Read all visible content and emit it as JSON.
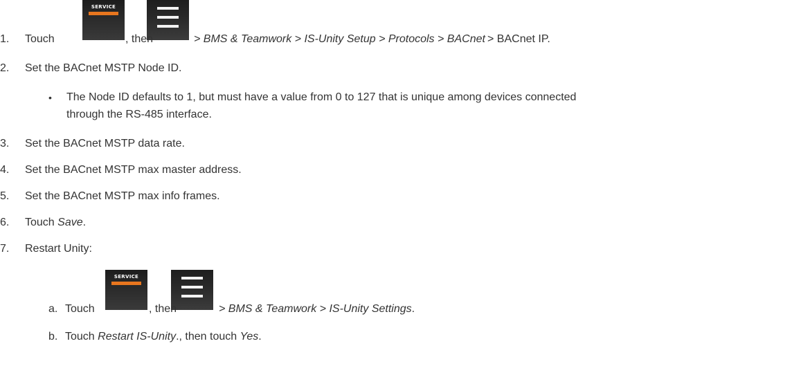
{
  "icons": {
    "service_label": "SERVICE",
    "service_accent": "#e8761e",
    "menu_icon": "hamburger-menu-icon"
  },
  "steps": [
    {
      "num": "1.",
      "touch": "Touch",
      "then": ", then",
      "path": "> BMS & Teamwork > IS-Unity Setup > Protocols > BACnet",
      "tail": "> BACnet IP."
    },
    {
      "num": "2.",
      "text": "Set the BACnet MSTP Node ID."
    },
    {
      "num": "3.",
      "text": "Set the BACnet MSTP data rate."
    },
    {
      "num": "4.",
      "text": "Set the BACnet MSTP max master address."
    },
    {
      "num": "5.",
      "text": "Set the BACnet MSTP max info frames."
    },
    {
      "num": "6.",
      "pre": "Touch",
      "em": "Save",
      "post": "."
    },
    {
      "num": "7.",
      "text": "Restart Unity:"
    }
  ],
  "bullet": {
    "glyph": "•",
    "line1": "The Node ID defaults to 1, but must have a value from 0 to 127 that is unique among devices connected",
    "line2": "through the RS-485 interface."
  },
  "substeps": [
    {
      "letter": "a.",
      "touch": "Touch",
      "then": ", then",
      "path": "> BMS & Teamwork > IS-Unity Settings",
      "post": "."
    },
    {
      "letter": "b.",
      "pre": "Touch",
      "em1": "Restart IS-Unity",
      "mid": "., then touch",
      "em2": "Yes",
      "post": "."
    }
  ]
}
